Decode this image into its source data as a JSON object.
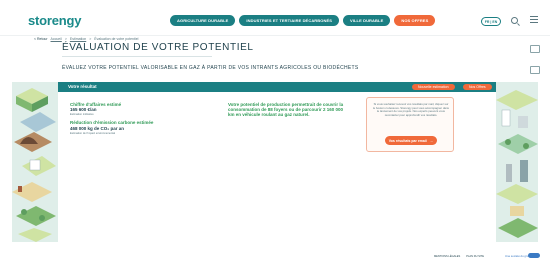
{
  "header": {
    "logo": "storengy",
    "nav": [
      {
        "label": "AGRICULTURE DURABLE"
      },
      {
        "label": "INDUSTRIES ET TERTIAIRE DÉCARBONÉS"
      },
      {
        "label": "VILLE DURABLE"
      },
      {
        "label": "NOS OFFRES"
      }
    ],
    "lang": "FR | EN"
  },
  "breadcrumb": {
    "back": "< Retour",
    "items": [
      "Accueil",
      "Estimation",
      "Évaluation de votre potentiel"
    ]
  },
  "page": {
    "title": "ÉVALUATION DE VOTRE POTENTIEL",
    "subtitle": "ÉVALUEZ VOTRE POTENTIEL VALORISABLE EN GAZ À PARTIR DE VOS INTRANTS AGRICOLES OU BIODÉCHETS"
  },
  "result": {
    "bar_label": "Votre résultat",
    "new_estimation": "Nouvelle estimation",
    "our_offer": "Nos Offres",
    "revenue_label": "Chiffre d'affaires estimé",
    "revenue_value": "165 600 €/an",
    "revenue_note": "Estimation indicative",
    "co2_label": "Réduction d'émission carbone estimée",
    "co2_value": "468 000 kg de CO₂ par an",
    "co2_note": "Estimation de l'impact environnemental",
    "production_text": "Votre potentiel de production permettrait de couvrir la consommation de 88 foyers ou de parcourir 2 160 000 km en véhicule roulant au gaz naturel.",
    "info_text": "Si vous souhaitez recevoir vos résultats par mail, cliquez sur le bouton ci-dessous. Storengy peut vous accompagner dans le lancement de vos projets. Nos experts peuvent vous recontacter pour approfondir vos résultats.",
    "send_button": "Vos résultats par email"
  },
  "footer": {
    "links": [
      "MENTIONS LÉGALES",
      "PLAN DU SITE"
    ],
    "brand": "Une société du groupe"
  }
}
